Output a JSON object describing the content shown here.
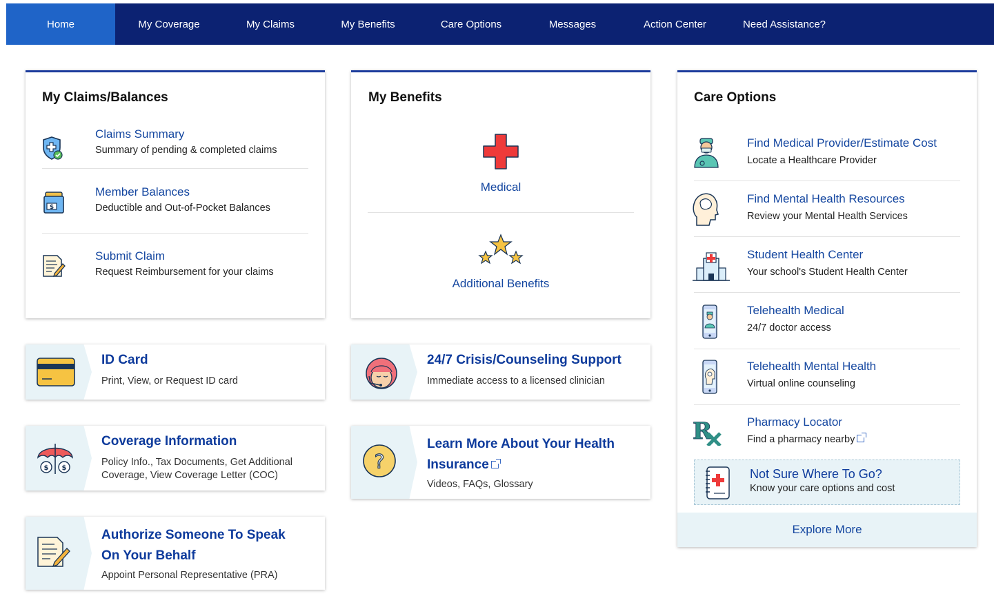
{
  "nav": [
    {
      "label": "Home",
      "active": true
    },
    {
      "label": "My Coverage"
    },
    {
      "label": "My Claims"
    },
    {
      "label": "My Benefits"
    },
    {
      "label": "Care Options"
    },
    {
      "label": "Messages"
    },
    {
      "label": "Action Center"
    },
    {
      "label": "Need Assistance?"
    }
  ],
  "claims_card": {
    "title": "My Claims/Balances",
    "items": [
      {
        "title": "Claims Summary",
        "desc": "Summary of pending & completed claims",
        "icon": "shield-check-icon"
      },
      {
        "title": "Member Balances",
        "desc": "Deductible and Out-of-Pocket Balances",
        "icon": "wallet-icon"
      },
      {
        "title": "Submit Claim",
        "desc": "Request Reimbursement for your claims",
        "icon": "document-pencil-icon"
      }
    ]
  },
  "benefits_card": {
    "title": "My Benefits",
    "items": [
      {
        "label": "Medical",
        "icon": "red-cross-icon"
      },
      {
        "label": "Additional Benefits",
        "icon": "stars-icon"
      }
    ]
  },
  "care_card": {
    "title": "Care Options",
    "items": [
      {
        "title": "Find Medical Provider/Estimate Cost",
        "desc": "Locate a Healthcare Provider",
        "icon": "doctor-icon"
      },
      {
        "title": "Find Mental Health Resources",
        "desc": "Review your Mental Health Services",
        "icon": "head-brain-icon"
      },
      {
        "title": "Student Health Center",
        "desc": "Your school's Student Health Center",
        "icon": "hospital-icon"
      },
      {
        "title": "Telehealth Medical",
        "desc": "24/7 doctor access",
        "icon": "phone-doctor-icon"
      },
      {
        "title": "Telehealth Mental Health",
        "desc": "Virtual online counseling",
        "icon": "phone-head-icon"
      },
      {
        "title": "Pharmacy Locator",
        "desc": "Find a pharmacy nearby",
        "icon": "rx-icon"
      }
    ],
    "callout": {
      "title": "Not Sure Where To Go?",
      "desc": "Know your care options and cost",
      "icon": "medical-guide-icon"
    },
    "explore": "Explore More"
  },
  "tiles": {
    "id_card": {
      "title": "ID Card",
      "desc": "Print, View, or Request ID card",
      "icon": "credit-card-icon"
    },
    "crisis": {
      "title": "24/7 Crisis/Counseling Support",
      "desc": "Immediate access to a licensed clinician",
      "icon": "headset-agent-icon"
    },
    "coverage": {
      "title": "Coverage Information",
      "desc": "Policy Info., Tax Documents, Get Additional Coverage, View Coverage Letter (COC)",
      "icon": "umbrella-money-icon"
    },
    "learn": {
      "title_line1": "Learn More About Your Health",
      "title_line2": "Insurance",
      "desc": "Videos, FAQs, Glossary",
      "icon": "question-icon"
    },
    "authorize": {
      "title_line1": "Authorize Someone To Speak",
      "title_line2": "On Your Behalf",
      "desc": "Appoint Personal Representative (PRA)",
      "icon": "document-pencil-icon"
    }
  },
  "colors": {
    "nav_bg": "#0c2272",
    "nav_active": "#1f64c8",
    "link": "#1547a0",
    "tile_title": "#0e3b9c",
    "tile_left": "#e8f3f7"
  }
}
